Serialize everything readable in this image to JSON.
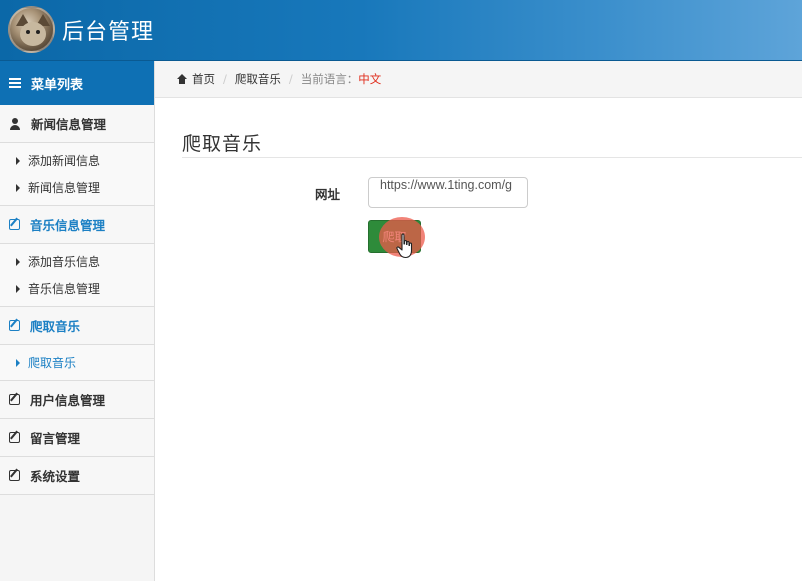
{
  "header": {
    "app_title": "后台管理"
  },
  "sidebar": {
    "menu_title": "菜单列表",
    "groups": [
      {
        "label": "新闻信息管理",
        "icon": "user-icon",
        "items": [
          "添加新闻信息",
          "新闻信息管理"
        ]
      },
      {
        "label": "音乐信息管理",
        "icon": "edit-icon",
        "items": [
          "添加音乐信息",
          "音乐信息管理"
        ]
      },
      {
        "label": "爬取音乐",
        "icon": "edit-icon",
        "items": [
          "爬取音乐"
        ]
      },
      {
        "label": "用户信息管理",
        "icon": "edit-icon",
        "items": []
      },
      {
        "label": "留言管理",
        "icon": "edit-icon",
        "items": []
      },
      {
        "label": "系统设置",
        "icon": "edit-icon",
        "items": []
      }
    ]
  },
  "breadcrumb": {
    "home": "首页",
    "current": "爬取音乐",
    "lang_label": "当前语言：",
    "lang_value": "中文"
  },
  "main": {
    "title": "爬取音乐",
    "url_label": "网址",
    "url_value": "https://www.1ting.com/g",
    "crawl_button": "爬取"
  },
  "colors": {
    "header_blue": "#0b68a8",
    "accent_blue": "#1c80c4",
    "button_green": "#2e8b3a",
    "lang_red": "#e02c1b"
  }
}
